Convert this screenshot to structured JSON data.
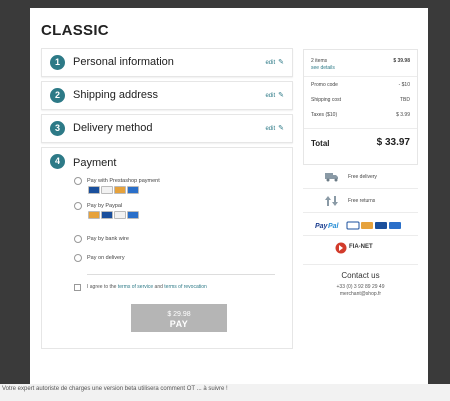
{
  "brand": {
    "logo": "CLASSIC"
  },
  "steps": [
    {
      "number": "1",
      "title": "Personal information",
      "edit": "edit"
    },
    {
      "number": "2",
      "title": "Shipping address",
      "edit": "edit"
    },
    {
      "number": "3",
      "title": "Delivery method",
      "edit": "edit"
    },
    {
      "number": "4",
      "title": "Payment"
    }
  ],
  "payment": {
    "options": [
      "Pay with Prestashop payment",
      "Pay by Paypal",
      "Pay by bank wire",
      "Pay on delivery"
    ],
    "terms": {
      "prefix": "I agree to the",
      "link1": "terms of service",
      "and": "and",
      "link2": "terms of revocation"
    },
    "button": {
      "amount": "$ 29.98",
      "label": "PAY"
    }
  },
  "summary": {
    "items": "2 items",
    "items_price": "$ 39.98",
    "see_details": "see details",
    "rows": [
      {
        "label": "Promo code",
        "value": "- $10"
      },
      {
        "label": "Shipping cost",
        "value": "TBD"
      },
      {
        "label": "Taxes ($10)",
        "value": "$ 3.99"
      }
    ],
    "total_label": "Total",
    "total_value": "$ 33.97"
  },
  "reassurance": {
    "free_delivery": "Free delivery",
    "free_returns": "Free returns",
    "fianet": "FIA-NET"
  },
  "contact": {
    "title": "Contact us",
    "phone": "+33 (0) 3 92 89 29 49",
    "email": "merchant@shop.fr"
  },
  "footer": {
    "text": "Votre expert autoriste de charges une version beta utilisera comment OT ... à suivre !"
  },
  "colors": {
    "accent": "#2d7a87",
    "button": "#b5b5b5",
    "backdrop": "#3a3a3a"
  }
}
